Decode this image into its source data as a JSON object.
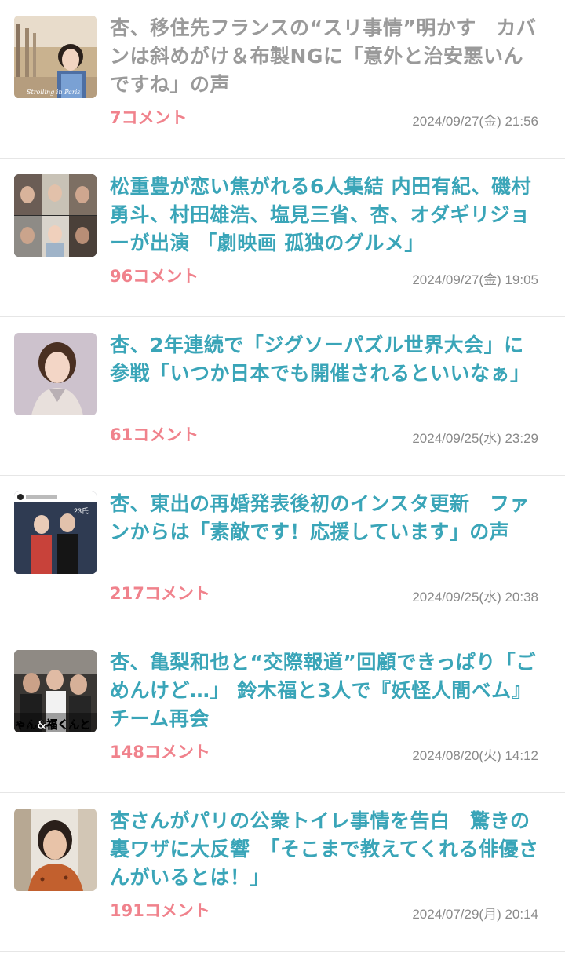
{
  "articles": [
    {
      "title": "杏、移住先フランスの“スリ事情”明かす　カバンは斜めがけ＆布製NGに「意外と治安悪いんですね」の声",
      "comments": "7コメント",
      "date": "2024/09/27(金) 21:56",
      "visited": true,
      "thumb_caption": "Strolling in Paris"
    },
    {
      "title": "松重豊が恋い焦がれる6人集結 内田有紀、磯村勇斗、村田雄浩、塩見三省、杏、オダギリジョーが出演 「劇映画 孤独のグルメ」",
      "comments": "96コメント",
      "date": "2024/09/27(金) 19:05",
      "visited": false
    },
    {
      "title": "杏、2年連続で「ジグソーパズル世界大会」に参戦「いつか日本でも開催されるといいなぁ」",
      "comments": "61コメント",
      "date": "2024/09/25(水) 23:29",
      "visited": false
    },
    {
      "title": "杏、東出の再婚発表後初のインスタ更新　ファンからは「素敵です！応援しています」の声",
      "comments": "217コメント",
      "date": "2024/09/25(水) 20:38",
      "visited": false,
      "thumb_caption": "23氏"
    },
    {
      "title": "杏、亀梨和也と“交際報道”回顧できっぱり「ごめんけど…」 鈴木福と3人で『妖怪人間ベム』チーム再会",
      "comments": "148コメント",
      "date": "2024/08/20(火) 14:12",
      "visited": false,
      "thumb_caption": "ゃん&福くんと"
    },
    {
      "title": "杏さんがパリの公衆トイレ事情を告白　驚きの裏ワザに大反響　「そこまで教えてくれる俳優さんがいるとは！」",
      "comments": "191コメント",
      "date": "2024/07/29(月) 20:14",
      "visited": false
    }
  ]
}
